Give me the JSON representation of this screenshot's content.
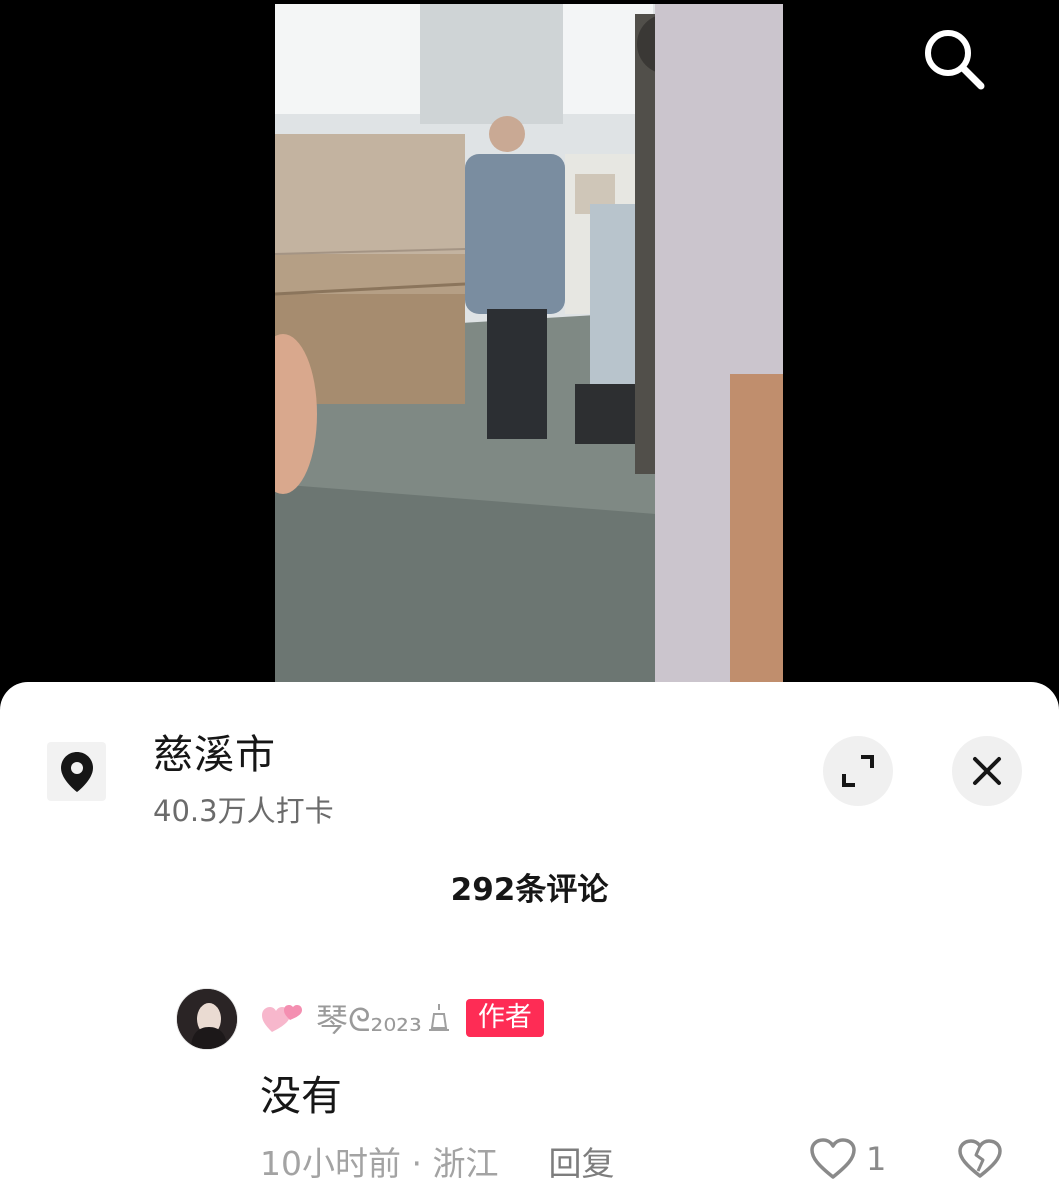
{
  "icons": {
    "search": "search-icon",
    "location": "location-pin-icon",
    "expand": "expand-icon",
    "close": "close-icon",
    "like": "heart-icon",
    "dislike": "broken-heart-icon"
  },
  "colors": {
    "author_badge": "#fe2c55",
    "sheet_background": "#ffffff",
    "video_background": "#000000"
  },
  "location": {
    "name": "慈溪市",
    "checkins": "40.3万人打卡"
  },
  "comments_header": {
    "count_label": "292条评论"
  },
  "comment": {
    "username": "琴ᘓ₂₀₂₃",
    "author_badge": "作者",
    "text": "没有",
    "time_location": "10小时前 · 浙江",
    "reply_label": "回复",
    "like_count": "1"
  }
}
